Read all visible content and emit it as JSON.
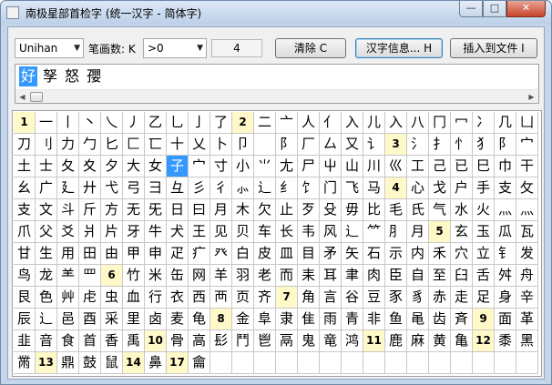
{
  "window": {
    "title": "南极星部首检字 (统一汉字 - 简体字)",
    "buttons": {
      "minimize": "—",
      "maximize": "□",
      "close": "✕"
    }
  },
  "toolbar": {
    "charset": "Unihan",
    "stroke_label": "笔画数: K",
    "stroke_value": ">0",
    "count": "4",
    "clear_label": "清除 C",
    "info_label": "汉字信息... H",
    "insert_label": "插入到文件 I"
  },
  "results": {
    "chars": [
      "好",
      "孥",
      "怒",
      "孾"
    ],
    "selected_index": 0
  },
  "grid": {
    "selected": "子",
    "rows": [
      [
        "1",
        "一",
        "丨",
        "丶",
        "乀",
        "丿",
        "乙",
        "乚",
        "亅",
        "了",
        "2",
        "二",
        "亠",
        "人",
        "亻",
        "入",
        "儿",
        "入",
        "八",
        "冂",
        "冖",
        "冫",
        "几",
        "凵"
      ],
      [
        "刀",
        "刂",
        "力",
        "勹",
        "匕",
        "匚",
        "匸",
        "十",
        "乂",
        "卜",
        "卩",
        "",
        "阝",
        "厂",
        "厶",
        "又",
        "讠",
        "3",
        "氵",
        "扌",
        "忄",
        "犭",
        "阝",
        "宀"
      ],
      [
        "土",
        "士",
        "夂",
        "夊",
        "夕",
        "大",
        "女",
        "子",
        "宀",
        "寸",
        "小",
        "⺌",
        "尢",
        "尸",
        "屮",
        "山",
        "川",
        "巛",
        "工",
        "己",
        "已",
        "巳",
        "巾",
        "干"
      ],
      [
        "幺",
        "广",
        "廴",
        "廾",
        "弋",
        "弓",
        "彐",
        "彑",
        "彡",
        "彳",
        "⺗",
        "辶",
        "纟",
        "饣",
        "门",
        "飞",
        "马",
        "4",
        "心",
        "戈",
        "户",
        "手",
        "支",
        "攵"
      ],
      [
        "支",
        "文",
        "斗",
        "斤",
        "方",
        "无",
        "旡",
        "日",
        "曰",
        "月",
        "木",
        "欠",
        "止",
        "歹",
        "殳",
        "毋",
        "比",
        "毛",
        "氏",
        "气",
        "水",
        "火",
        "灬",
        "⺣"
      ],
      [
        "爪",
        "父",
        "爻",
        "爿",
        "片",
        "牙",
        "牛",
        "犬",
        "王",
        "见",
        "贝",
        "车",
        "长",
        "韦",
        "风",
        "辶",
        "⺮",
        "⺼",
        "月",
        "5",
        "玄",
        "玉",
        "瓜",
        "瓦"
      ],
      [
        "甘",
        "生",
        "用",
        "田",
        "由",
        "甲",
        "申",
        "疋",
        "疒",
        "癶",
        "白",
        "皮",
        "皿",
        "目",
        "矛",
        "矢",
        "石",
        "示",
        "内",
        "禾",
        "穴",
        "立",
        "钅",
        "发"
      ],
      [
        "鸟",
        "龙",
        "⺷",
        "罒",
        "6",
        "竹",
        "米",
        "缶",
        "网",
        "羊",
        "羽",
        "老",
        "而",
        "耒",
        "耳",
        "聿",
        "肉",
        "臣",
        "自",
        "至",
        "臼",
        "舌",
        "舛",
        "舟"
      ],
      [
        "艮",
        "色",
        "艸",
        "虍",
        "虫",
        "血",
        "行",
        "衣",
        "西",
        "襾",
        "页",
        "齐",
        "7",
        "角",
        "言",
        "谷",
        "豆",
        "豕",
        "豸",
        "赤",
        "走",
        "足",
        "身",
        "辛"
      ],
      [
        "辰",
        "辶",
        "邑",
        "酉",
        "采",
        "里",
        "卤",
        "麦",
        "龟",
        "8",
        "金",
        "阜",
        "隶",
        "隹",
        "雨",
        "青",
        "非",
        "鱼",
        "黾",
        "齿",
        "斉",
        "9",
        "面",
        "革"
      ],
      [
        "韭",
        "音",
        "食",
        "首",
        "香",
        "禹",
        "10",
        "骨",
        "高",
        "髟",
        "鬥",
        "鬯",
        "鬲",
        "鬼",
        "竜",
        "鸿",
        "11",
        "鹿",
        "麻",
        "黄",
        "亀",
        "12",
        "黍",
        "黑"
      ],
      [
        "黹",
        "13",
        "鼎",
        "鼓",
        "鼠",
        "14",
        "鼻",
        "17",
        "龠",
        "",
        "",
        "",
        "",
        "",
        "",
        "",
        "",
        "",
        "",
        "",
        "",
        "",
        "",
        ""
      ]
    ]
  }
}
